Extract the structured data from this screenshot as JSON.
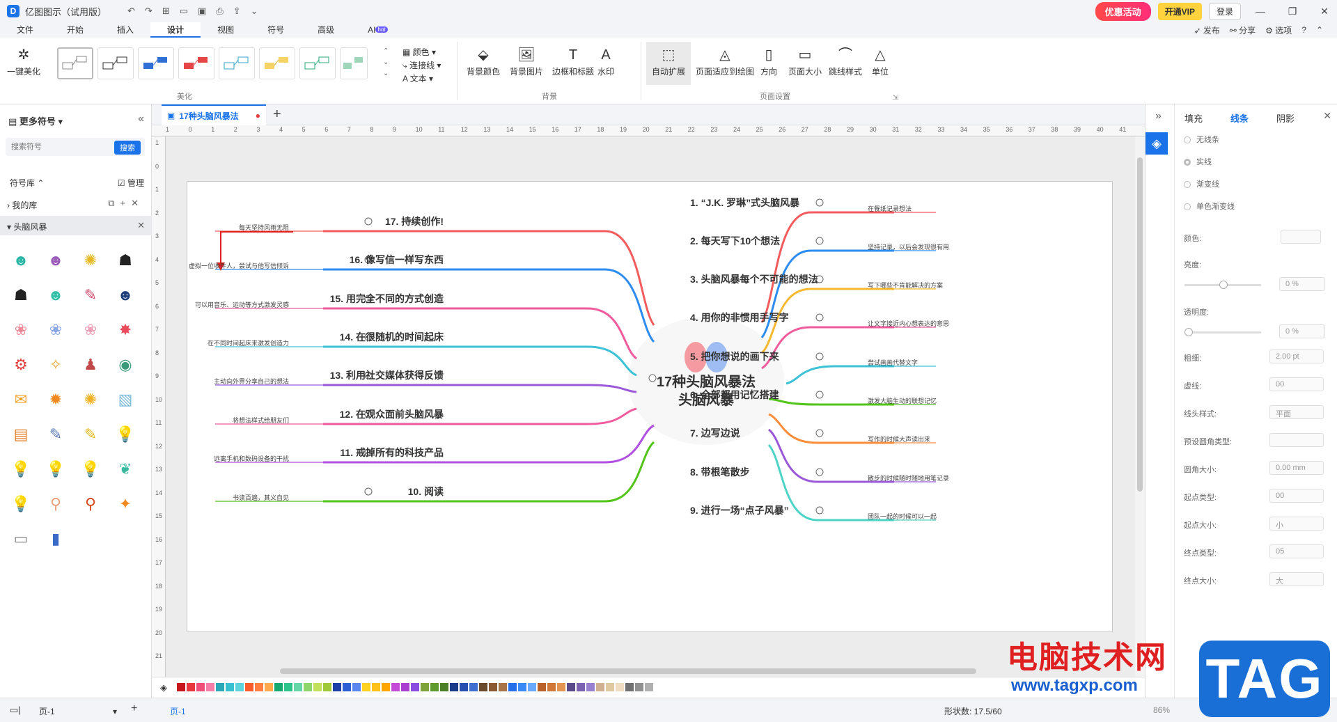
{
  "app": {
    "title": "亿图图示（试用版）",
    "promo": "优惠活动",
    "vip": "开通VIP",
    "login": "登录"
  },
  "menus": [
    "文件",
    "开始",
    "插入",
    "设计",
    "视图",
    "符号",
    "高级",
    "AI"
  ],
  "menu_badge": "hot",
  "menu_right": {
    "publish": "发布",
    "share": "分享",
    "options": "选项",
    "help": "?"
  },
  "ribbon": {
    "beautify": "一键美化",
    "beautify_group": "美化",
    "color": "颜色",
    "connector": "连接线",
    "text": "文本",
    "bg_color": "背景颜色",
    "bg_image": "背景图片",
    "border_title": "边框和标题",
    "watermark": "水印",
    "bg_group": "背景",
    "auto_expand": "自动扩展",
    "fit_page": "页面适应到绘图",
    "direction": "方向",
    "page_size": "页面大小",
    "jump_style": "跳线样式",
    "unit": "单位",
    "page_group": "页面设置"
  },
  "left": {
    "more_symbols": "更多符号",
    "search_placeholder": "搜索符号",
    "search_btn": "搜索",
    "library": "符号库",
    "manage": "管理",
    "my_lib": "我的库",
    "category": "头脑风暴"
  },
  "doc": {
    "tab": "17种头脑风暴法"
  },
  "ruler_h": [
    "1",
    "0",
    "1",
    "2",
    "3",
    "4",
    "5",
    "6",
    "7",
    "8",
    "9",
    "10",
    "11",
    "12",
    "13",
    "14",
    "15",
    "16",
    "17",
    "18",
    "19",
    "20",
    "21",
    "22",
    "23",
    "24",
    "25",
    "26",
    "27",
    "28",
    "29",
    "30",
    "31",
    "32",
    "33",
    "34",
    "35",
    "36",
    "37",
    "38",
    "39",
    "40",
    "41"
  ],
  "ruler_v": [
    "1",
    "0",
    "1",
    "2",
    "3",
    "4",
    "5",
    "6",
    "7",
    "8",
    "9",
    "10",
    "11",
    "12",
    "13",
    "14",
    "15",
    "16",
    "17",
    "18",
    "19",
    "20",
    "21"
  ],
  "mindmap": {
    "center_line1": "17种头脑风暴法",
    "center_line2": "头脑风暴",
    "right": [
      {
        "title": "1. “J.K. 罗琳”式头脑风暴",
        "note": "在餐纸记录想法",
        "color": "#f25c5c"
      },
      {
        "title": "2. 每天写下10个想法",
        "note": "坚持记录，以后会发现很有用",
        "color": "#2d8cf0"
      },
      {
        "title": "3. 头脑风暴每个不可能的想法",
        "note": "写下哪些不肯能解决的方案",
        "color": "#f5b82e"
      },
      {
        "title": "4. 用你的非惯用手写字",
        "note": "让文字接近内心想表达的意思",
        "color": "#ef5b9c"
      },
      {
        "title": "5. 把你想说的画下来",
        "note": "尝试画画代替文字",
        "color": "#3cc1d6"
      },
      {
        "title": "6. 全部都用记忆搭建",
        "note": "激发大脑生动的联想记忆",
        "color": "#52c41a"
      },
      {
        "title": "7. 边写边说",
        "note": "写作的时候大声读出来",
        "color": "#fa8c3a"
      },
      {
        "title": "8. 带根笔散步",
        "note": "散步的时候随时随地用笔记录",
        "color": "#9b59d9"
      },
      {
        "title": "9. 进行一场“点子风暴”",
        "note": "团队一起的时候可以一起",
        "color": "#4ed4c6"
      }
    ],
    "left": [
      {
        "title": "17. 持续创作!",
        "note": "每天坚持风雨无阻",
        "color": "#f25c5c"
      },
      {
        "title": "16. 像写信一样写东西",
        "note": "虚拟一位收件人，尝试与他写信倾诉",
        "color": "#2d8cf0"
      },
      {
        "title": "15. 用完全不同的方式创造",
        "note": "可以用音乐、运动等方式激发灵感",
        "color": "#ef5b9c"
      },
      {
        "title": "14. 在很随机的时间起床",
        "note": "在不同时间起床来激发创造力",
        "color": "#3cc1d6"
      },
      {
        "title": "13. 利用社交媒体获得反馈",
        "note": "主动向外界分享自己的想法",
        "color": "#9b59d9"
      },
      {
        "title": "12. 在观众面前头脑风暴",
        "note": "将想法样式给朋友们",
        "color": "#ef5b9c"
      },
      {
        "title": "11. 戒掉所有的科技产品",
        "note": "远离手机和数码设备的干扰",
        "color": "#b04fe0"
      },
      {
        "title": "10. 阅读",
        "note": "书读百遍，其义自见",
        "color": "#52c41a"
      }
    ]
  },
  "right_panel": {
    "tabs": [
      "填充",
      "线条",
      "阴影"
    ],
    "options": [
      "无线条",
      "实线",
      "渐变线",
      "单色渐变线"
    ],
    "color": "颜色:",
    "brightness": "亮度:",
    "brightness_val": "0 %",
    "transparency": "透明度:",
    "transparency_val": "0 %",
    "width": "粗细:",
    "width_val": "2.00 pt",
    "dash": "虚线:",
    "dash_val": "00",
    "cap": "线头样式:",
    "cap_val": "平面",
    "corner_type": "预设圆角类型:",
    "corner_size": "圆角大小:",
    "corner_val": "0.00 mm",
    "start_type": "起点类型:",
    "start_type_val": "00",
    "start_size": "起点大小:",
    "start_size_val": "小",
    "end_type": "终点类型:",
    "end_type_val": "05",
    "end_size": "终点大小:",
    "end_size_val": "大"
  },
  "status": {
    "page_tab": "页-1",
    "page_current": "页-1",
    "shapes": "形状数: 17.5/60",
    "zoom": "86%"
  },
  "watermark": {
    "text": "电脑技术网",
    "url": "www.tagxp.com",
    "tag": "TAG"
  },
  "palette": [
    "#c8161d",
    "#e8383d",
    "#f04f7a",
    "#f57ea8",
    "#2aa8b8",
    "#36c0d0",
    "#5dd3e0",
    "#fa5d2b",
    "#ff7f3e",
    "#ffa94d",
    "#13a86f",
    "#2cc48a",
    "#65d6a8",
    "#8ed66b",
    "#c2e05a",
    "#a0c93a",
    "#1c3fa8",
    "#2d5fd4",
    "#5a86f0",
    "#ffd21f",
    "#ffc017",
    "#ffa600",
    "#c44bd6",
    "#a93ed0",
    "#8c4ce0",
    "#7ea33a",
    "#5f9a2f",
    "#4a7f28",
    "#1a3a8a",
    "#274fb0",
    "#3d6ed0",
    "#6a4a2a",
    "#8b5a33",
    "#a87448",
    "#2570e8",
    "#3a8af5",
    "#68aaf9",
    "#b8622a",
    "#d07838",
    "#e39450",
    "#5a4a8a",
    "#7a62b0",
    "#9a80d0",
    "#d0b090",
    "#e0c8a0",
    "#f0dcc0",
    "#707070",
    "#909090",
    "#b0b0b0"
  ]
}
